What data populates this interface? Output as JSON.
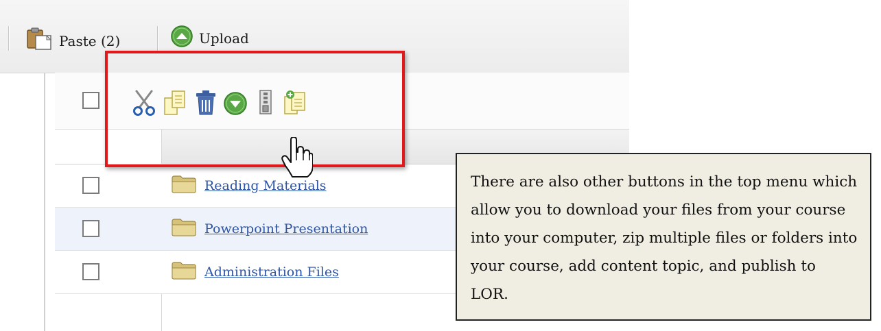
{
  "toolbar": {
    "paste_label": "Paste (2)",
    "upload_label": "Upload"
  },
  "file_list": {
    "rows": [
      {
        "name": "Reading Materials",
        "type": "folder"
      },
      {
        "name": "Powerpoint Presentation",
        "type": "folder"
      },
      {
        "name": "Administration Files",
        "type": "folder"
      }
    ]
  },
  "action_icons": [
    "scissors-icon",
    "copy-icon",
    "trash-icon",
    "download-icon",
    "zip-icon",
    "add-topic-icon"
  ],
  "callout": {
    "text": "There are also other buttons in the top menu which allow you to download your files from your course into your computer, zip multiple files or folders into your course, add content topic, and publish to LOR."
  },
  "colors": {
    "highlight": "#e0191c",
    "link": "#2e55a5",
    "callout_bg": "#f0eee2",
    "alt_row": "#eef3fb",
    "upload_green": "#5aa845"
  }
}
